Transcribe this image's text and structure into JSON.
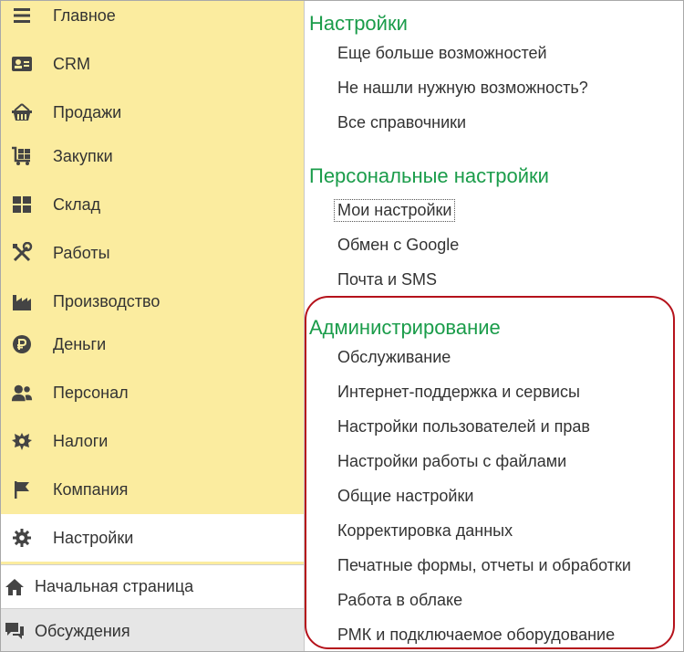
{
  "sidebar": {
    "items": [
      {
        "label": "Главное",
        "icon": "menu-icon"
      },
      {
        "label": "CRM",
        "icon": "contact-card-icon"
      },
      {
        "label": "Продажи",
        "icon": "basket-icon"
      },
      {
        "label": "Закупки",
        "icon": "cart-icon"
      },
      {
        "label": "Склад",
        "icon": "warehouse-grid-icon"
      },
      {
        "label": "Работы",
        "icon": "tools-icon"
      },
      {
        "label": "Производство",
        "icon": "factory-icon"
      },
      {
        "label": "Деньги",
        "icon": "ruble-icon"
      },
      {
        "label": "Персонал",
        "icon": "people-icon"
      },
      {
        "label": "Налоги",
        "icon": "emblem-icon"
      },
      {
        "label": "Компания",
        "icon": "flag-icon"
      },
      {
        "label": "Настройки",
        "icon": "gear-icon",
        "active": true
      }
    ],
    "home_label": "Начальная страница",
    "discussions_label": "Обсуждения"
  },
  "content": {
    "settings": {
      "title": "Настройки",
      "links": [
        "Еще больше возможностей",
        "Не нашли нужную возможность?",
        "Все справочники"
      ]
    },
    "personal": {
      "title": "Персональные настройки",
      "links": [
        "Мои настройки",
        "Обмен с Google",
        "Почта и SMS"
      ]
    },
    "admin": {
      "title": "Администрирование",
      "links": [
        "Обслуживание",
        "Интернет-поддержка и сервисы",
        "Настройки пользователей и прав",
        "Настройки работы с файлами",
        "Общие настройки",
        "Корректировка данных",
        "Печатные формы, отчеты и обработки",
        "Работа в облаке",
        "РМК и подключаемое оборудование"
      ]
    }
  },
  "colors": {
    "sidebar_bg": "#fbec9f",
    "section_title": "#1a9c4a",
    "highlight_border": "#b5121b"
  }
}
